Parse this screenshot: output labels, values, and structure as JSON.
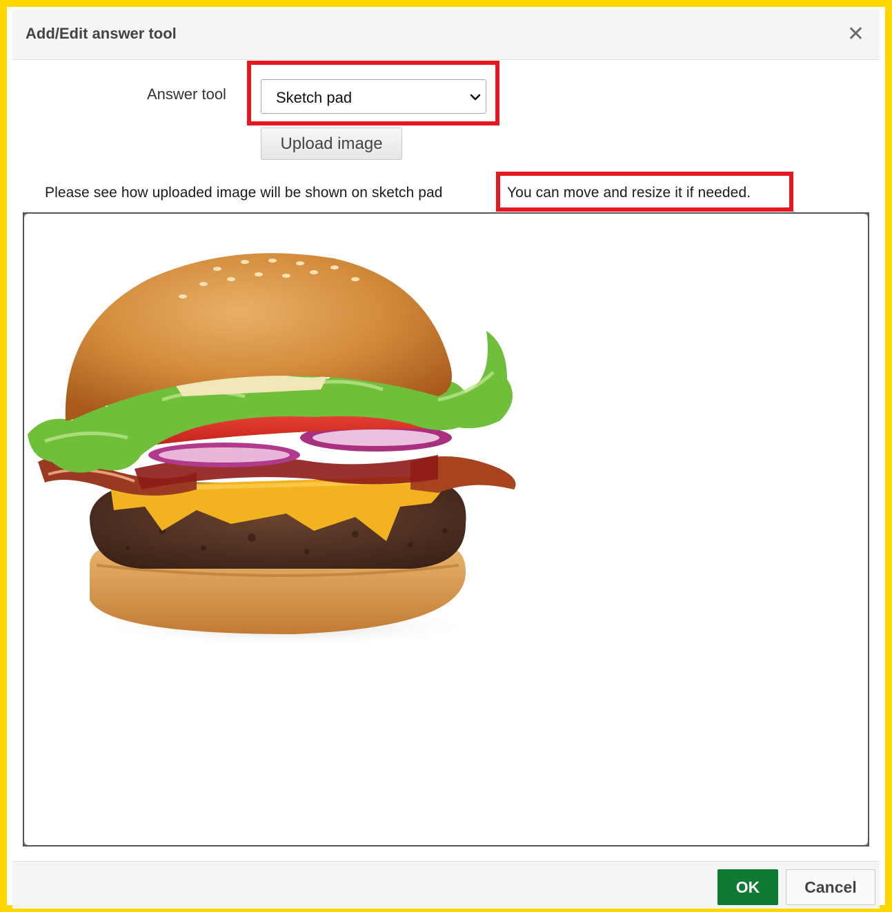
{
  "dialog": {
    "title": "Add/Edit answer tool",
    "close_glyph": "✕"
  },
  "form": {
    "answer_tool_label": "Answer tool",
    "answer_tool_value": "Sketch pad",
    "upload_label": "Upload image"
  },
  "info": {
    "text_part1": "Please see how uploaded image will be shown on sketch pad",
    "text_part2": "You can move and resize it if needed."
  },
  "sketch_pad": {
    "image": "burger-image"
  },
  "footer": {
    "ok_label": "OK",
    "cancel_label": "Cancel"
  },
  "colors": {
    "frame": "#ffd700",
    "highlight": "#e3191f",
    "ok_button": "#0f7a34"
  }
}
